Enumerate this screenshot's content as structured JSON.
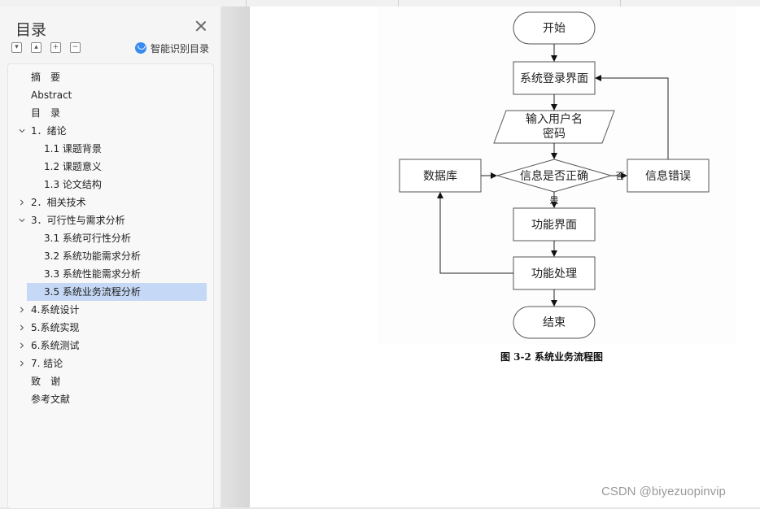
{
  "panel": {
    "title": "目录",
    "tool_buttons": [
      "▾",
      "▴",
      "+",
      "−"
    ],
    "smart_label": "智能识别目录"
  },
  "toc": [
    {
      "label": "摘　要",
      "level": 0,
      "chevron": ""
    },
    {
      "label": "Abstract",
      "level": 0,
      "chevron": ""
    },
    {
      "label": "目　录",
      "level": 0,
      "chevron": ""
    },
    {
      "label": "1．绪论",
      "level": 0,
      "chevron": "down"
    },
    {
      "label": "1.1  课题背景",
      "level": 1,
      "chevron": ""
    },
    {
      "label": "1.2  课题意义",
      "level": 1,
      "chevron": ""
    },
    {
      "label": "1.3  论文结构",
      "level": 1,
      "chevron": ""
    },
    {
      "label": "2．相关技术",
      "level": 0,
      "chevron": "right"
    },
    {
      "label": "3．可行性与需求分析",
      "level": 0,
      "chevron": "down"
    },
    {
      "label": "3.1  系统可行性分析",
      "level": 1,
      "chevron": ""
    },
    {
      "label": "3.2  系统功能需求分析",
      "level": 1,
      "chevron": ""
    },
    {
      "label": "3.3  系统性能需求分析",
      "level": 1,
      "chevron": ""
    },
    {
      "label": "3.5  系统业务流程分析",
      "level": 1,
      "chevron": "",
      "selected": true
    },
    {
      "label": "4.系统设计",
      "level": 0,
      "chevron": "right"
    },
    {
      "label": "5.系统实现",
      "level": 0,
      "chevron": "right"
    },
    {
      "label": "6.系统测试",
      "level": 0,
      "chevron": "right"
    },
    {
      "label": "7. 结论",
      "level": 0,
      "chevron": "right"
    },
    {
      "label": "致　谢",
      "level": 0,
      "chevron": ""
    },
    {
      "label": "参考文献",
      "level": 0,
      "chevron": ""
    }
  ],
  "flow": {
    "start": "开始",
    "login": "系统登录界面",
    "input_line1": "输入用户名",
    "input_line2": "密码",
    "check": "信息是否正确",
    "database": "数据库",
    "error": "信息错误",
    "no_label": "否",
    "yes_label": "是",
    "func_ui": "功能界面",
    "func_proc": "功能处理",
    "end": "结束"
  },
  "caption": "图 3-2  系统业务流程图",
  "watermark": "CSDN @biyezuopinvip"
}
